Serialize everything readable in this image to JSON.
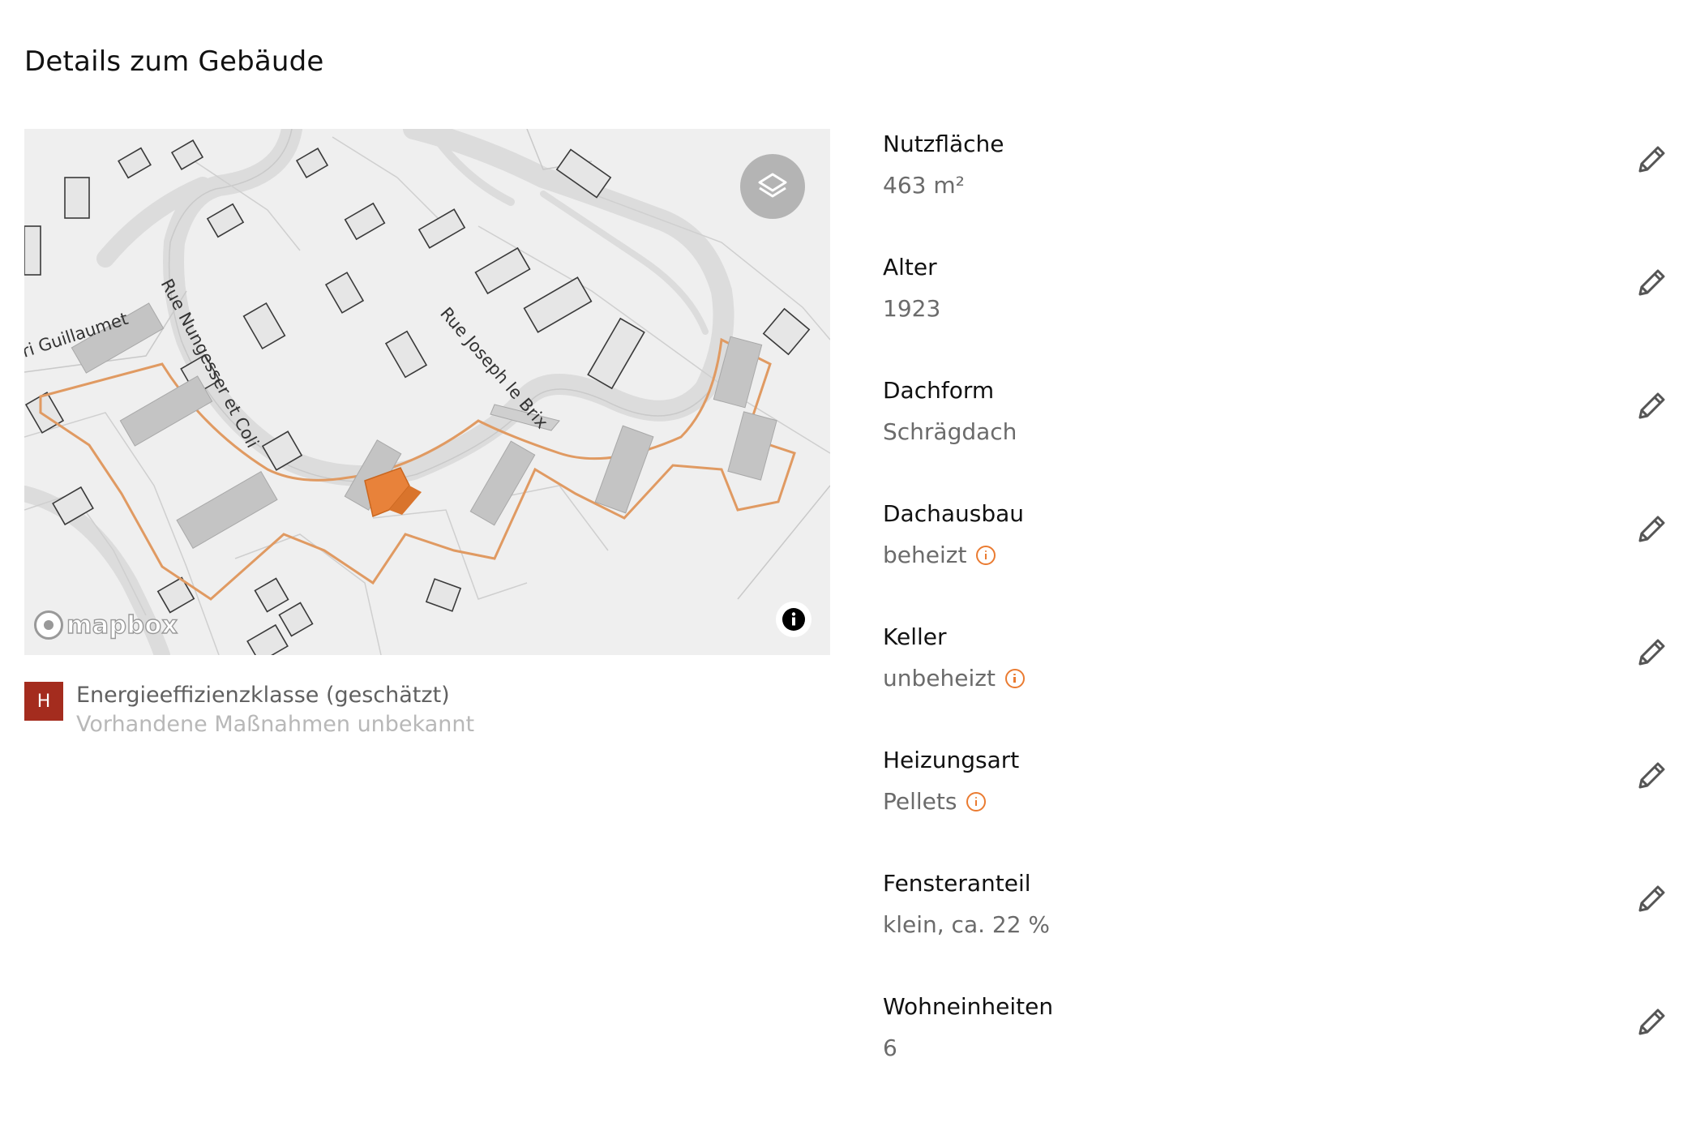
{
  "page": {
    "title": "Details zum Gebäude"
  },
  "map": {
    "streets": [
      "Rue Nungesser et Coli",
      "Rue Joseph le Brix",
      "ri Guillaumet"
    ],
    "attribution": "mapbox",
    "highlight_color": "#e8823a",
    "outline_color": "#e09a62",
    "icons": {
      "layers": "layers-icon",
      "info": "info-icon"
    }
  },
  "energy": {
    "class": "H",
    "class_color": "#a42c1e",
    "label": "Energieeffizienzklasse (geschätzt)",
    "note": "Vorhandene Maßnahmen unbekannt"
  },
  "details": [
    {
      "label": "Nutzfläche",
      "value": "463 m²",
      "info": false
    },
    {
      "label": "Alter",
      "value": "1923",
      "info": false
    },
    {
      "label": "Dachform",
      "value": "Schrägdach",
      "info": false
    },
    {
      "label": "Dachausbau",
      "value": "beheizt",
      "info": true
    },
    {
      "label": "Keller",
      "value": "unbeheizt",
      "info": true
    },
    {
      "label": "Heizungsart",
      "value": "Pellets",
      "info": true
    },
    {
      "label": "Fensteranteil",
      "value": "klein, ca. 22 %",
      "info": false
    },
    {
      "label": "Wohneinheiten",
      "value": "6",
      "info": false
    }
  ],
  "colors": {
    "accent": "#ea7b31",
    "label": "#111111",
    "value": "#6b6b6b"
  }
}
